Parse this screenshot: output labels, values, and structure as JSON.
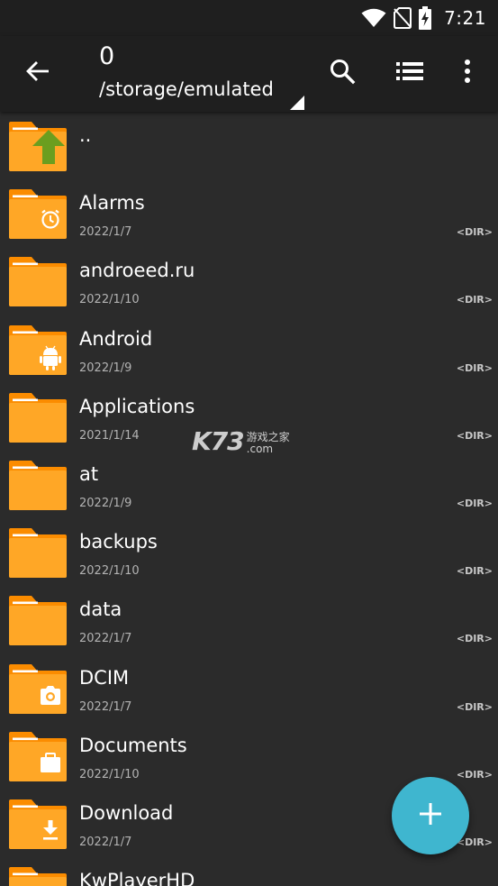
{
  "status_bar": {
    "time": "7:21",
    "icons": [
      "wifi-icon",
      "no-sim-icon",
      "battery-charging-icon"
    ]
  },
  "app_bar": {
    "title": "0",
    "path": "/storage/emulated",
    "icons": [
      "back-arrow-icon",
      "search-icon",
      "list-view-icon",
      "more-vert-icon"
    ]
  },
  "files": [
    {
      "name": "..",
      "date": "",
      "type": "",
      "overlay": "up-arrow"
    },
    {
      "name": "Alarms",
      "date": "2022/1/7",
      "type": "<DIR>",
      "overlay": "alarm"
    },
    {
      "name": "androeed.ru",
      "date": "2022/1/10",
      "type": "<DIR>",
      "overlay": ""
    },
    {
      "name": "Android",
      "date": "2022/1/9",
      "type": "<DIR>",
      "overlay": "android"
    },
    {
      "name": "Applications",
      "date": "2021/1/14",
      "type": "<DIR>",
      "overlay": ""
    },
    {
      "name": "at",
      "date": "2022/1/9",
      "type": "<DIR>",
      "overlay": ""
    },
    {
      "name": "backups",
      "date": "2022/1/10",
      "type": "<DIR>",
      "overlay": ""
    },
    {
      "name": "data",
      "date": "2022/1/7",
      "type": "<DIR>",
      "overlay": ""
    },
    {
      "name": "DCIM",
      "date": "2022/1/7",
      "type": "<DIR>",
      "overlay": "camera"
    },
    {
      "name": "Documents",
      "date": "2022/1/10",
      "type": "<DIR>",
      "overlay": "briefcase"
    },
    {
      "name": "Download",
      "date": "2022/1/7",
      "type": "<DIR>",
      "overlay": "download"
    },
    {
      "name": "KwPlayerHD",
      "date": "",
      "type": "",
      "overlay": ""
    }
  ],
  "watermark": {
    "main": "K73",
    "line1": "游戏之家",
    "line2": ".com"
  },
  "fab": {
    "icon": "plus-icon"
  },
  "colors": {
    "background": "#2b2b2b",
    "app_bar": "#1f1f1f",
    "folder_front": "#ffa726",
    "folder_back": "#fb8c00",
    "folder_tab_line": "#ffffff",
    "fab": "#3fb6cf",
    "up_arrow": "#6b9e1f"
  }
}
